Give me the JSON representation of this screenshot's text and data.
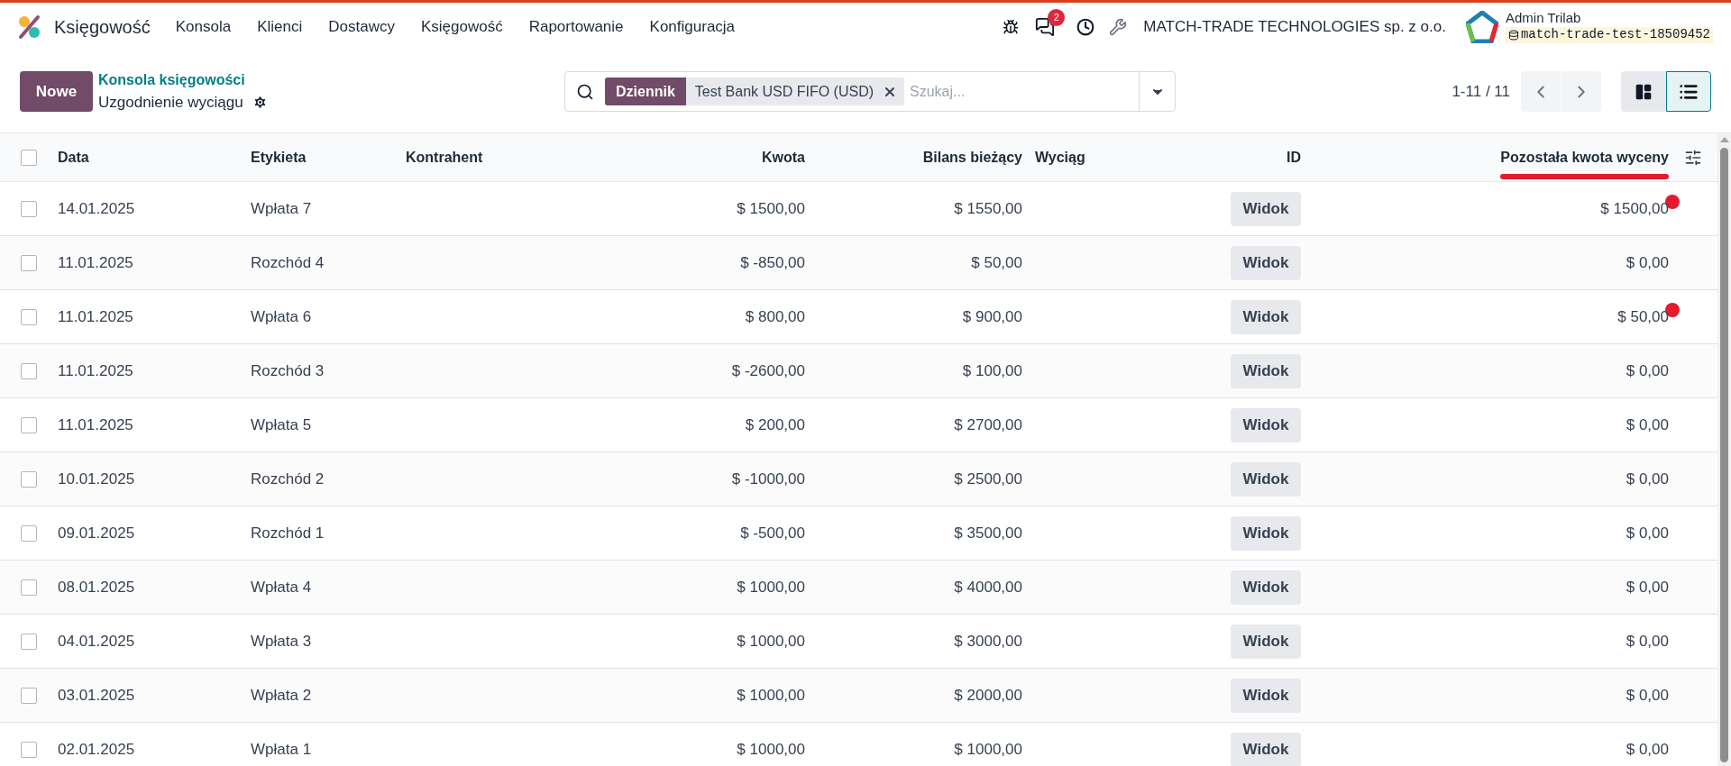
{
  "navbar": {
    "app_name": "Księgowość",
    "menu": [
      "Konsola",
      "Klienci",
      "Dostawcy",
      "Księgowość",
      "Raportowanie",
      "Konfiguracja"
    ],
    "messages_count": "2",
    "company": "MATCH-TRADE TECHNOLOGIES sp. z o.o.",
    "user": "Admin Trilab",
    "database": "match-trade-test-18509452"
  },
  "control_panel": {
    "new_button": "Nowe",
    "breadcrumb": "Konsola księgowości",
    "title": "Uzgodnienie wyciągu",
    "search": {
      "facet_label": "Dziennik",
      "facet_value": "Test Bank USD FIFO (USD)",
      "placeholder": "Szukaj..."
    },
    "pager": "1-11 / 11",
    "views": [
      {
        "kind": "kanban",
        "selected": false
      },
      {
        "kind": "list",
        "selected": true
      }
    ]
  },
  "table": {
    "select_all_checked": false,
    "columns": [
      {
        "label": "Data",
        "underlined": false
      },
      {
        "label": "Etykieta",
        "underlined": false
      },
      {
        "label": "Kontrahent",
        "underlined": false
      },
      {
        "label": "Kwota",
        "underlined": false
      },
      {
        "label": "Bilans bieżący",
        "underlined": false
      },
      {
        "label": "Wyciąg",
        "underlined": false
      },
      {
        "label": "ID",
        "underlined": false
      },
      {
        "label": "Pozostała kwota wyceny",
        "underlined": true
      }
    ],
    "rows": [
      {
        "checked": false,
        "date": "14.01.2025",
        "label": "Wpłata 7",
        "amount": "$ 1500,00",
        "balance": "$ 1550,00",
        "button": "Widok",
        "remaining": "$ 1500,00",
        "marked": true
      },
      {
        "checked": false,
        "date": "11.01.2025",
        "label": "Rozchód 4",
        "amount": "$ -850,00",
        "balance": "$ 50,00",
        "button": "Widok",
        "remaining": "$ 0,00",
        "marked": false
      },
      {
        "checked": false,
        "date": "11.01.2025",
        "label": "Wpłata 6",
        "amount": "$ 800,00",
        "balance": "$ 900,00",
        "button": "Widok",
        "remaining": "$ 50,00",
        "marked": true
      },
      {
        "checked": false,
        "date": "11.01.2025",
        "label": "Rozchód 3",
        "amount": "$ -2600,00",
        "balance": "$ 100,00",
        "button": "Widok",
        "remaining": "$ 0,00",
        "marked": false
      },
      {
        "checked": false,
        "date": "11.01.2025",
        "label": "Wpłata 5",
        "amount": "$ 200,00",
        "balance": "$ 2700,00",
        "button": "Widok",
        "remaining": "$ 0,00",
        "marked": false
      },
      {
        "checked": false,
        "date": "10.01.2025",
        "label": "Rozchód 2",
        "amount": "$ -1000,00",
        "balance": "$ 2500,00",
        "button": "Widok",
        "remaining": "$ 0,00",
        "marked": false
      },
      {
        "checked": false,
        "date": "09.01.2025",
        "label": "Rozchód 1",
        "amount": "$ -500,00",
        "balance": "$ 3500,00",
        "button": "Widok",
        "remaining": "$ 0,00",
        "marked": false
      },
      {
        "checked": false,
        "date": "08.01.2025",
        "label": "Wpłata 4",
        "amount": "$ 1000,00",
        "balance": "$ 4000,00",
        "button": "Widok",
        "remaining": "$ 0,00",
        "marked": false
      },
      {
        "checked": false,
        "date": "04.01.2025",
        "label": "Wpłata 3",
        "amount": "$ 1000,00",
        "balance": "$ 3000,00",
        "button": "Widok",
        "remaining": "$ 0,00",
        "marked": false
      },
      {
        "checked": false,
        "date": "03.01.2025",
        "label": "Wpłata 2",
        "amount": "$ 1000,00",
        "balance": "$ 2000,00",
        "button": "Widok",
        "remaining": "$ 0,00",
        "marked": false
      },
      {
        "checked": false,
        "date": "02.01.2025",
        "label": "Wpłata 1",
        "amount": "$ 1000,00",
        "balance": "$ 1000,00",
        "button": "Widok",
        "remaining": "$ 0,00",
        "marked": false
      }
    ]
  }
}
